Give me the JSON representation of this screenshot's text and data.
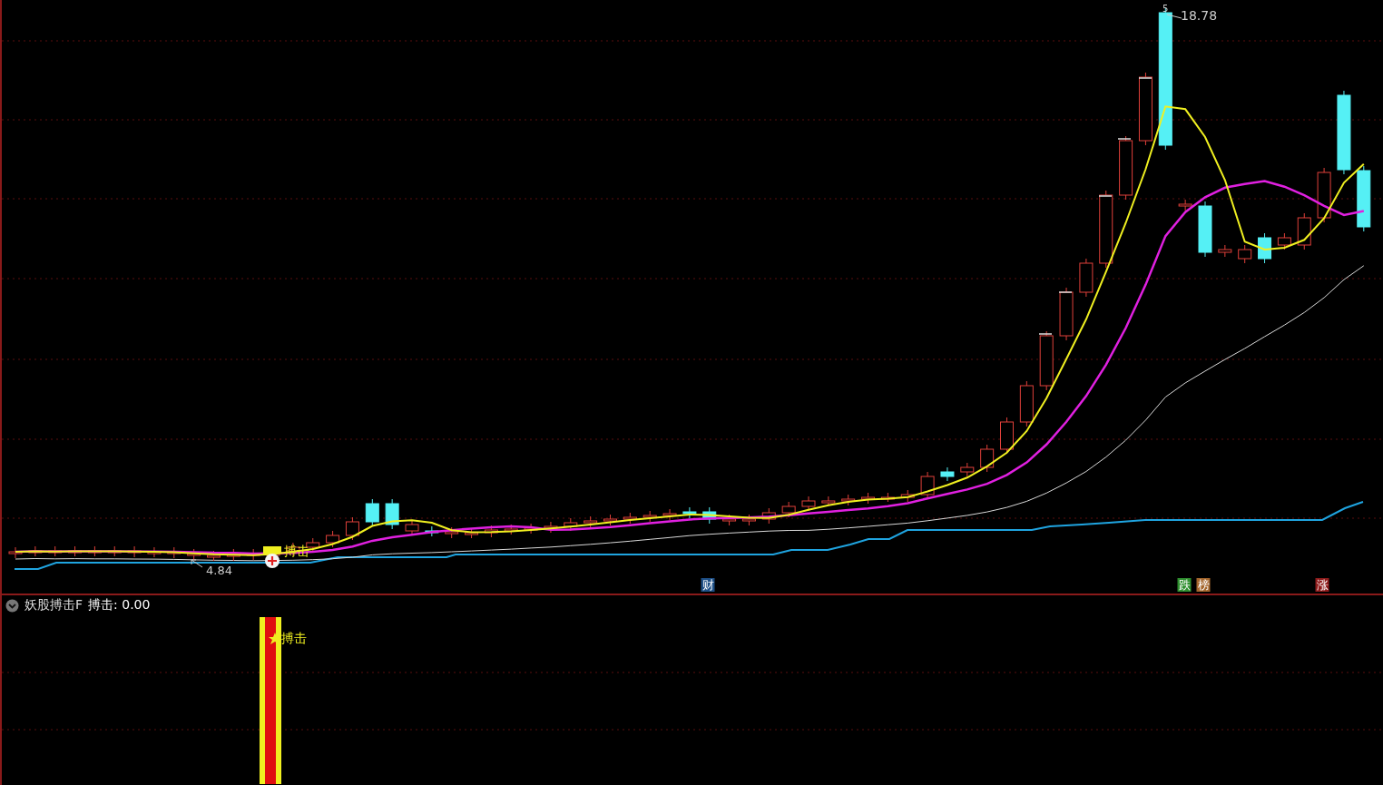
{
  "main_chart": {
    "high_marker": "5",
    "high_price": "18.78",
    "low_price": "4.84",
    "signal_label": "搏击",
    "tags": [
      {
        "label": "财",
        "color": "#1d4f86"
      },
      {
        "label": "跌",
        "color": "#2f8f2f"
      },
      {
        "label": "榜",
        "color": "#a4662c"
      },
      {
        "label": "涨",
        "color": "#8e1b1b"
      }
    ]
  },
  "indicator_panel": {
    "title": "妖股搏击F",
    "reading": "搏击: 0.00",
    "signal_label": "搏击"
  }
}
